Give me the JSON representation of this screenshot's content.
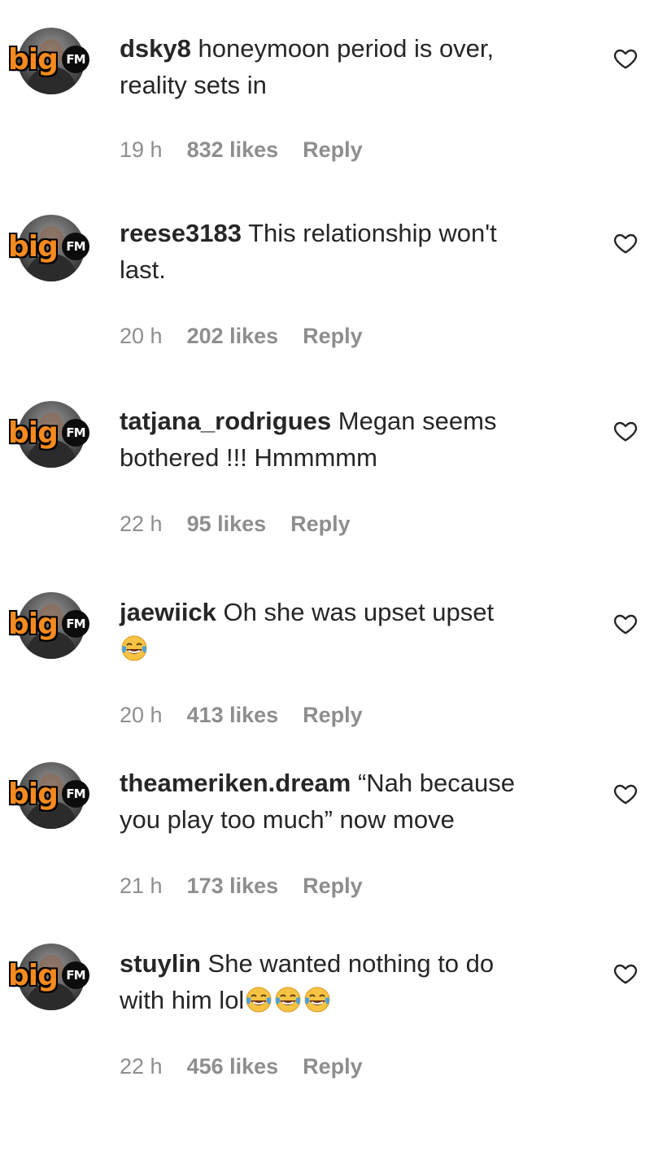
{
  "avatar_logo": {
    "big": "big",
    "fm": "FM"
  },
  "comments": [
    {
      "username": "dsky8",
      "text": "honeymoon period is over, reality sets in",
      "emoji_count": 0,
      "time": "19 h",
      "likes": "832 likes",
      "reply": "Reply"
    },
    {
      "username": "reese3183",
      "text": "This relationship won't last.",
      "emoji_count": 0,
      "time": "20 h",
      "likes": "202 likes",
      "reply": "Reply"
    },
    {
      "username": "tatjana_rodrigues",
      "text": "Megan seems bothered !!! Hmmmmm",
      "emoji_count": 0,
      "time": "22 h",
      "likes": "95 likes",
      "reply": "Reply"
    },
    {
      "username": "jaewiick",
      "text": "Oh she was upset upset",
      "emoji_count": 1,
      "time": "20 h",
      "likes": "413 likes",
      "reply": "Reply"
    },
    {
      "username": "theameriken.dream",
      "text": "“Nah because you play too much” now move",
      "emoji_count": 0,
      "time": "21 h",
      "likes": "173 likes",
      "reply": "Reply"
    },
    {
      "username": "stuylin",
      "text": "She wanted nothing to do with him lol",
      "emoji_count": 3,
      "time": "22 h",
      "likes": "456 likes",
      "reply": "Reply"
    }
  ],
  "icons": {
    "like": "heart-outline-icon",
    "emoji": "face-with-tears-of-joy-emoji"
  },
  "colors": {
    "text": "#262626",
    "meta": "#8e8e8e",
    "logo_orange": "#f58a1f"
  }
}
